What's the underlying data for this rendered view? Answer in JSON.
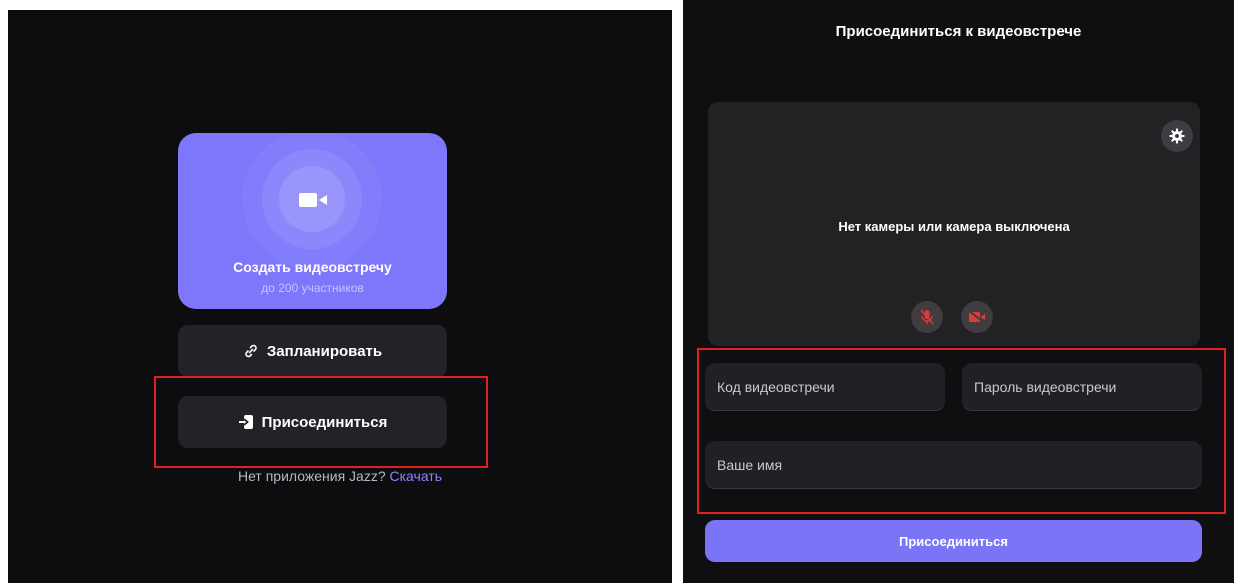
{
  "left": {
    "create_card": {
      "title": "Создать видеовстречу",
      "subtitle": "до 200 участников",
      "icon": "video-camera-icon"
    },
    "schedule_button": {
      "label": "Запланировать",
      "icon": "link-icon"
    },
    "join_button": {
      "label": "Присоединиться",
      "icon": "enter-icon"
    },
    "no_app": {
      "text": "Нет приложения Jazz?",
      "link": "Скачать"
    }
  },
  "right": {
    "title": "Присоединиться к видеовстрече",
    "preview": {
      "message": "Нет камеры или камера выключена",
      "settings_icon": "gear-icon",
      "mic_icon": "mic-off-icon",
      "camera_icon": "camera-off-icon"
    },
    "fields": {
      "code_placeholder": "Код видеовстречи",
      "password_placeholder": "Пароль видеовстречи",
      "name_placeholder": "Ваше имя"
    },
    "submit_label": "Присоединиться"
  },
  "colors": {
    "accent": "#7e77fb",
    "background": "#0d0c0f",
    "highlight": "#e01f1f",
    "muted_red": "#e03a3a"
  }
}
